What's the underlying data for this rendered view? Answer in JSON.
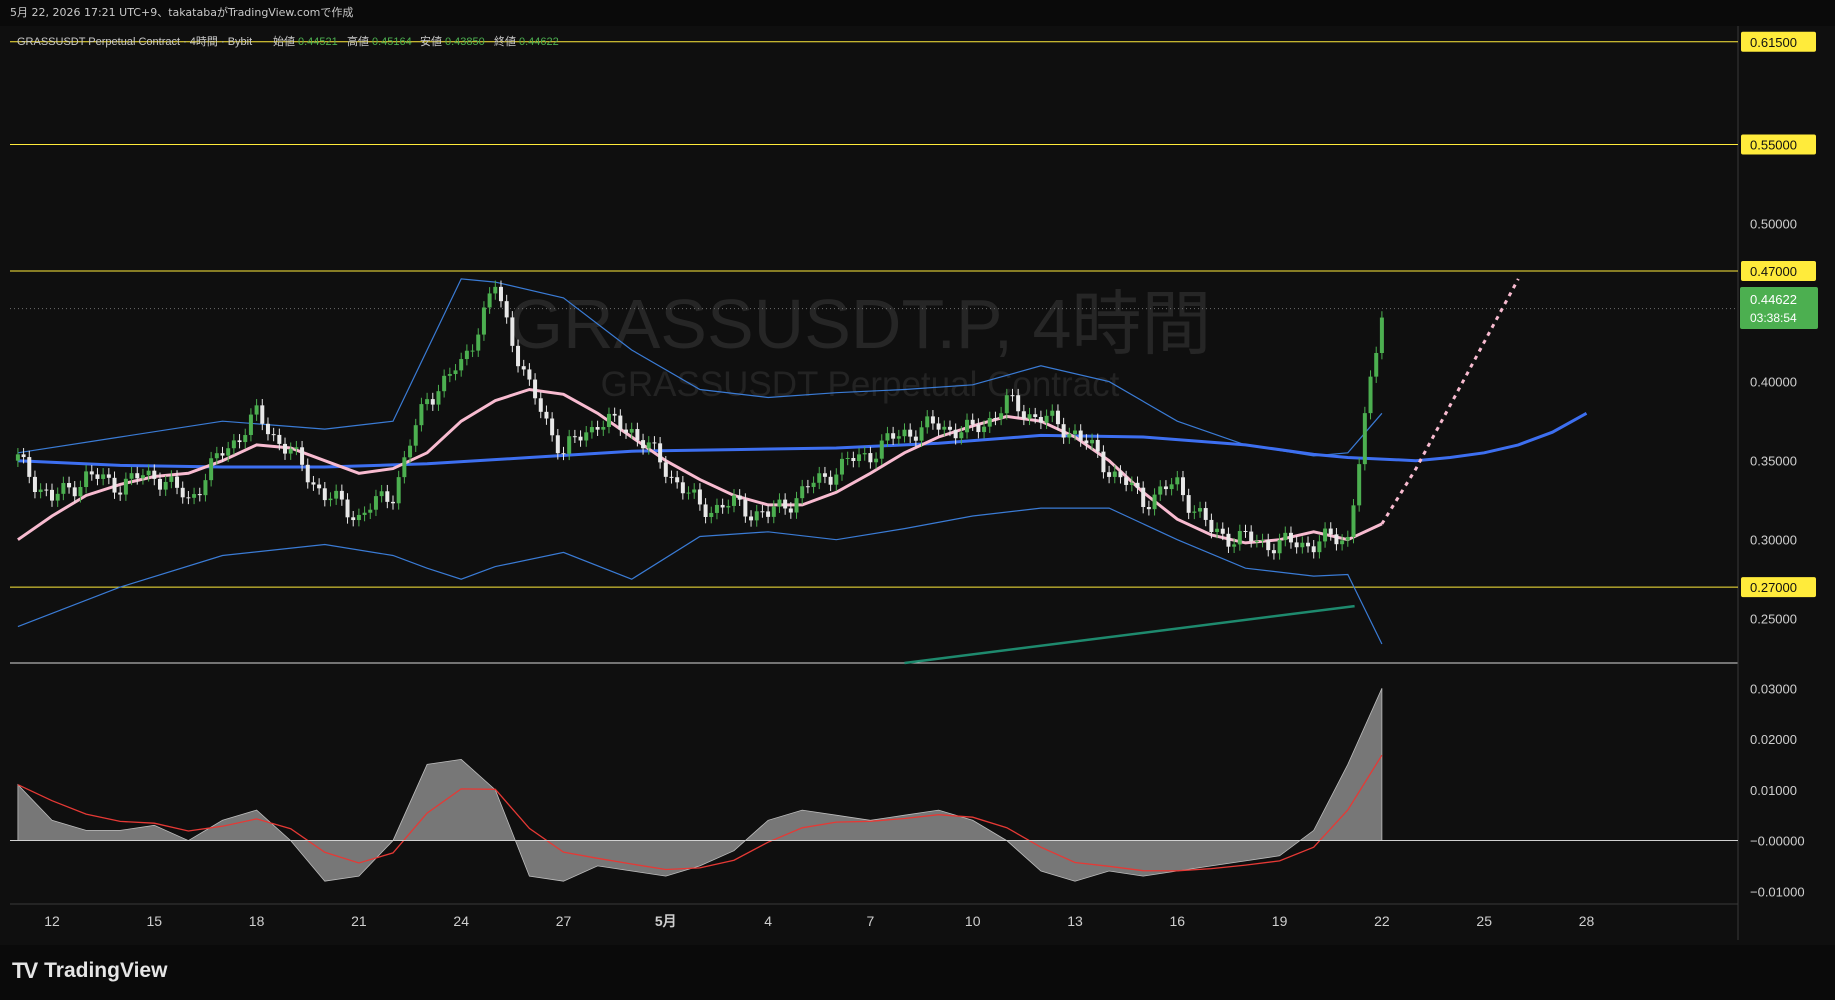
{
  "header": {
    "timestamp_text": "5月 22, 2026 17:21 UTC+9、takatabaがTradingView.comで作成"
  },
  "legend": {
    "symbol": "GRASSUSDT Perpetual Contract · 4時間 · Bybit",
    "open_label": "始値",
    "open_value": "0.44521",
    "high_label": "高値",
    "high_value": "0.45164",
    "low_label": "安値",
    "low_value": "0.43850",
    "close_label": "終値",
    "close_value": "0.44622"
  },
  "watermark": {
    "line1": "GRASSUSDT.P, 4時間",
    "line2": "GRASSUSDT Perpetual Contract"
  },
  "price_badge": {
    "price": "0.44622",
    "countdown": "03:38:54"
  },
  "brand": {
    "name": "TradingView"
  },
  "colors": {
    "background": "#0f0f0f",
    "up_candle": "#4caf50",
    "down_candle": "#e8e8e8",
    "hline": "#ffeb3b",
    "last_price": "#4caf50",
    "ma_pink": "#f8bbd0",
    "ma_blue": "#3d6ff0",
    "ma_green": "#8bc34a",
    "bollinger": "#3a7bd5",
    "oscillator_fill": "#8a8a8a",
    "signal_line": "#e53935",
    "trendline": "#1e8a6e"
  },
  "chart_data": [
    {
      "type": "candlestick",
      "title": "GRASSUSDT.P, 4時間",
      "x_tick_labels": [
        "12",
        "15",
        "18",
        "21",
        "24",
        "27",
        "5月",
        "4",
        "7",
        "10",
        "13",
        "16",
        "19",
        "22",
        "25",
        "28"
      ],
      "y_tick_labels": [
        "0.25000",
        "0.30000",
        "0.35000",
        "0.40000",
        "0.50000"
      ],
      "ylim": [
        0.222,
        0.625
      ],
      "horizontal_levels": [
        "0.61500",
        "0.55000",
        "0.47000",
        "0.27000"
      ],
      "last_price": 0.44622,
      "ohlc_last": {
        "open": 0.44521,
        "high": 0.45164,
        "low": 0.4385,
        "close": 0.44622
      },
      "price_path": {
        "x": [
          11,
          12,
          13,
          14,
          15,
          16,
          17,
          18,
          19,
          20,
          21,
          22,
          23,
          24,
          25,
          26,
          27,
          28,
          29,
          30,
          31,
          32,
          33,
          34,
          35,
          36,
          37,
          38,
          39,
          40,
          41,
          42,
          43,
          44,
          45,
          46,
          47,
          48,
          49,
          50,
          51,
          52,
          53,
          54,
          55,
          56,
          57
        ],
        "y": [
          0.35,
          0.325,
          0.34,
          0.335,
          0.342,
          0.325,
          0.355,
          0.378,
          0.355,
          0.328,
          0.315,
          0.33,
          0.39,
          0.41,
          0.46,
          0.395,
          0.355,
          0.375,
          0.37,
          0.345,
          0.32,
          0.322,
          0.315,
          0.33,
          0.345,
          0.355,
          0.368,
          0.372,
          0.368,
          0.386,
          0.377,
          0.368,
          0.345,
          0.325,
          0.335,
          0.305,
          0.3,
          0.297,
          0.298,
          0.302,
          0.445,
          null,
          null,
          null,
          null,
          null,
          null
        ]
      },
      "ma_fast": {
        "x": [
          11,
          12,
          13,
          14,
          15,
          16,
          17,
          18,
          19,
          20,
          21,
          22,
          23,
          24,
          25,
          26,
          27,
          28,
          29,
          30,
          31,
          32,
          33,
          34,
          35,
          36,
          37,
          38,
          39,
          40,
          41,
          42,
          43,
          44,
          45,
          46,
          47,
          48,
          49,
          50,
          51
        ],
        "y": [
          0.3,
          0.315,
          0.328,
          0.335,
          0.34,
          0.342,
          0.35,
          0.36,
          0.358,
          0.35,
          0.342,
          0.345,
          0.355,
          0.375,
          0.388,
          0.395,
          0.392,
          0.38,
          0.365,
          0.35,
          0.338,
          0.328,
          0.322,
          0.322,
          0.33,
          0.342,
          0.355,
          0.365,
          0.372,
          0.378,
          0.375,
          0.365,
          0.35,
          0.33,
          0.313,
          0.303,
          0.298,
          0.3,
          0.305,
          0.3,
          0.31
        ]
      },
      "ma_slow": {
        "x": [
          11,
          14,
          17,
          20,
          23,
          26,
          29,
          32,
          35,
          38,
          41,
          44,
          47,
          49,
          50,
          51,
          52,
          53,
          54,
          55,
          56,
          57
        ],
        "y": [
          0.35,
          0.347,
          0.346,
          0.346,
          0.348,
          0.352,
          0.356,
          0.357,
          0.358,
          0.361,
          0.366,
          0.365,
          0.36,
          0.354,
          0.352,
          0.351,
          0.35,
          0.352,
          0.355,
          0.36,
          0.368,
          0.38
        ]
      },
      "ma_projection_pink": {
        "x": [
          51,
          52,
          53,
          54,
          55
        ],
        "y": [
          0.31,
          0.345,
          0.385,
          0.425,
          0.465
        ]
      },
      "bollinger_upper": {
        "x": [
          11,
          14,
          17,
          20,
          22,
          23,
          24,
          25,
          27,
          29,
          31,
          33,
          35,
          37,
          39,
          41,
          43,
          45,
          47,
          49,
          50,
          51
        ],
        "y": [
          0.355,
          0.365,
          0.375,
          0.37,
          0.375,
          0.42,
          0.465,
          0.463,
          0.453,
          0.42,
          0.395,
          0.39,
          0.393,
          0.395,
          0.398,
          0.41,
          0.4,
          0.375,
          0.36,
          0.353,
          0.355,
          0.38
        ]
      },
      "bollinger_lower": {
        "x": [
          11,
          14,
          17,
          20,
          22,
          23,
          24,
          25,
          27,
          29,
          31,
          33,
          35,
          37,
          39,
          41,
          43,
          45,
          47,
          49,
          50,
          51
        ],
        "y": [
          0.245,
          0.27,
          0.29,
          0.297,
          0.29,
          0.282,
          0.275,
          0.283,
          0.292,
          0.275,
          0.302,
          0.305,
          0.3,
          0.307,
          0.315,
          0.32,
          0.32,
          0.3,
          0.282,
          0.277,
          0.278,
          0.234
        ]
      },
      "oscillator": {
        "ylim": [
          -0.0125,
          0.034
        ],
        "y_tick_labels": [
          "0.03000",
          "0.02000",
          "0.01000",
          "−0.00000",
          "−0.01000"
        ],
        "x": [
          11,
          12,
          13,
          14,
          15,
          16,
          17,
          18,
          19,
          20,
          21,
          22,
          23,
          24,
          25,
          26,
          27,
          28,
          29,
          30,
          31,
          32,
          33,
          34,
          35,
          36,
          37,
          38,
          39,
          40,
          41,
          42,
          43,
          44,
          45,
          46,
          47,
          48,
          49,
          50,
          51
        ],
        "y": [
          0.011,
          0.004,
          0.002,
          0.002,
          0.003,
          0.0,
          0.004,
          0.006,
          0.0,
          -0.008,
          -0.007,
          0.0,
          0.015,
          0.016,
          0.01,
          -0.007,
          -0.008,
          -0.005,
          -0.006,
          -0.007,
          -0.005,
          -0.002,
          0.004,
          0.006,
          0.005,
          0.004,
          0.005,
          0.006,
          0.004,
          0.0,
          -0.006,
          -0.008,
          -0.006,
          -0.007,
          -0.006,
          -0.005,
          -0.004,
          -0.003,
          0.002,
          0.015,
          0.03
        ]
      }
    }
  ]
}
